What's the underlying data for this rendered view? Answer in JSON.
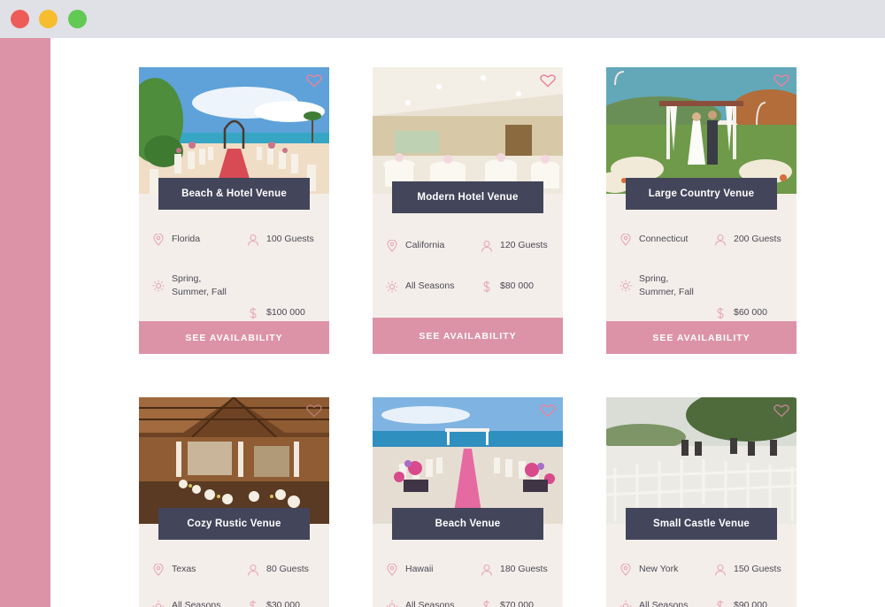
{
  "window": {
    "controls": [
      "close",
      "minimize",
      "zoom"
    ]
  },
  "colors": {
    "accent": "#dc93a8",
    "tag": "#43455a",
    "card_bg": "#f4eeea",
    "icon": "#e8a5b8"
  },
  "venues": [
    {
      "name": "Beach & Hotel Venue",
      "location": "Florida",
      "guests": "100 Guests",
      "seasons": "Spring,\nSummer, Fall",
      "price": "$100 000",
      "cta": "SEE AVAILABILITY"
    },
    {
      "name": "Modern Hotel Venue",
      "location": "California",
      "guests": "120 Guests",
      "seasons": "All Seasons",
      "price": "$80 000",
      "cta": "SEE AVAILABILITY"
    },
    {
      "name": "Large Country Venue",
      "location": "Connecticut",
      "guests": "200 Guests",
      "seasons": "Spring,\nSummer, Fall",
      "price": "$60 000",
      "cta": "SEE AVAILABILITY"
    },
    {
      "name": "Cozy Rustic Venue",
      "location": "Texas",
      "guests": "80 Guests",
      "seasons": "All Seasons",
      "price": "$30 000"
    },
    {
      "name": "Beach Venue",
      "location": "Hawaii",
      "guests": "180 Guests",
      "seasons": "All Seasons",
      "price": "$70 000"
    },
    {
      "name": "Small Castle Venue",
      "location": "New York",
      "guests": "150 Guests",
      "seasons": "All Seasons",
      "price": "$90 000"
    }
  ],
  "icons": {
    "favorite": "heart-icon",
    "location": "map-pin-icon",
    "guests": "user-icon",
    "seasons": "sun-icon",
    "price": "dollar-icon"
  }
}
